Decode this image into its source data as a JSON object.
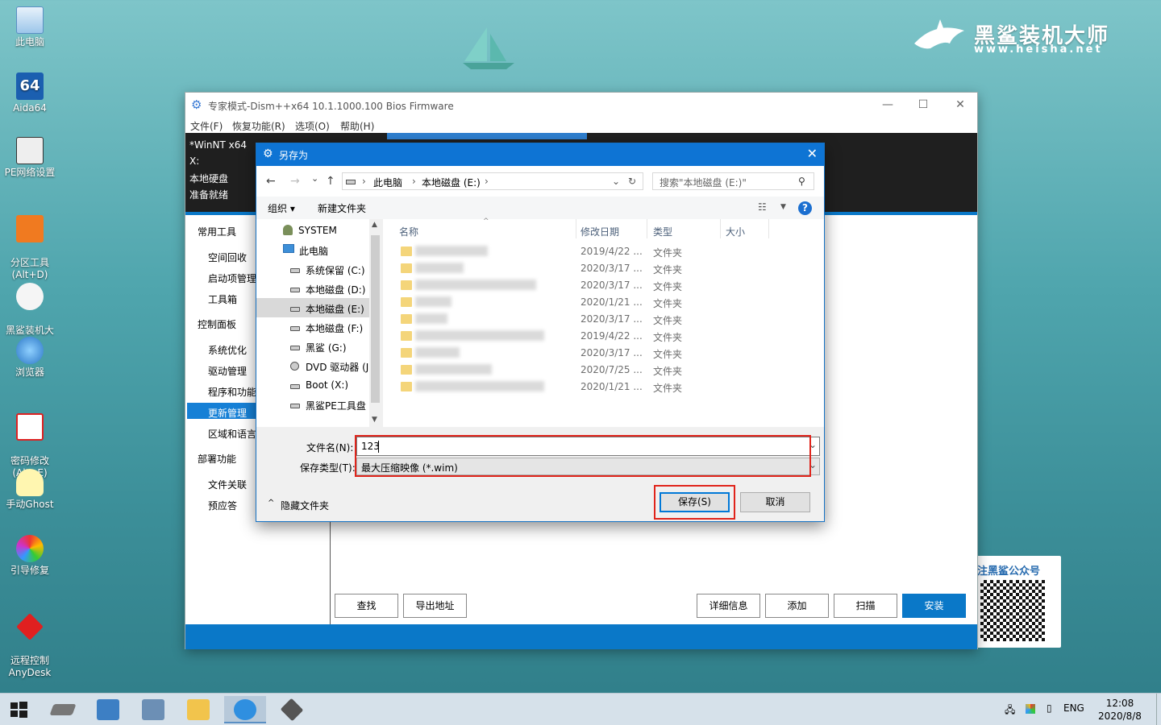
{
  "desktop": {
    "icons": [
      {
        "label": "此电脑"
      },
      {
        "label": "Aida64",
        "glyph": "64"
      },
      {
        "label": "PE网络设置"
      },
      {
        "label": "分区工具\n(Alt+D)"
      },
      {
        "label": "黑鲨装机大\n师"
      },
      {
        "label": "浏览器"
      },
      {
        "label": "密码修改\n(Alt+E)"
      },
      {
        "label": "手动Ghost"
      },
      {
        "label": "引导修复"
      },
      {
        "label": "远程控制\nAnyDesk"
      }
    ],
    "brand": {
      "name": "黑鲨装机大师",
      "url": "www.heisha.net"
    },
    "qr_caption": "注黑鲨公众号"
  },
  "main_window": {
    "title": "专家模式-Dism++x64 10.1.1000.100 Bios Firmware",
    "controls": {
      "minimize": "—",
      "maximize": "☐",
      "close": "✕"
    },
    "menu": [
      "文件(F)",
      "恢复功能(R)",
      "选项(O)",
      "帮助(H)"
    ],
    "info": [
      "*WinNT x64",
      "X:",
      "本地硬盘",
      "准备就绪"
    ],
    "sidebar": {
      "groups": [
        {
          "header": "常用工具",
          "items": [
            "空间回收",
            "启动项管理",
            "工具箱"
          ]
        },
        {
          "header": "控制面板",
          "items": [
            "系统优化",
            "驱动管理",
            "程序和功能",
            "更新管理",
            "区域和语言"
          ]
        },
        {
          "header": "部署功能",
          "items": [
            "文件关联",
            "预应答"
          ]
        }
      ],
      "selected": "更新管理"
    },
    "buttons": {
      "find": "查找",
      "export": "导出地址",
      "details": "详细信息",
      "add": "添加",
      "scan": "扫描",
      "install": "安装"
    }
  },
  "dialog": {
    "title": "另存为",
    "close": "✕",
    "nav": {
      "back": "←",
      "forward": "→",
      "down": "⌄",
      "up": "↑",
      "refresh": "↻"
    },
    "breadcrumb": [
      "此电脑",
      "本地磁盘 (E:)"
    ],
    "search_placeholder": "搜索\"本地磁盘 (E:)\"",
    "toolbar": {
      "organize": "组织 ▾",
      "new_folder": "新建文件夹",
      "help": "?"
    },
    "tree": [
      {
        "label": "SYSTEM"
      },
      {
        "label": "此电脑"
      },
      {
        "label": "系统保留 (C:)"
      },
      {
        "label": "本地磁盘 (D:)"
      },
      {
        "label": "本地磁盘 (E:)"
      },
      {
        "label": "本地磁盘 (F:)"
      },
      {
        "label": "黑鲨 (G:)"
      },
      {
        "label": "DVD 驱动器 (J"
      },
      {
        "label": "Boot (X:)"
      },
      {
        "label": "黑鲨PE工具盘"
      }
    ],
    "tree_selected": "本地磁盘 (E:)",
    "columns": {
      "name": "名称",
      "modified": "修改日期",
      "type": "类型",
      "size": "大小"
    },
    "files": [
      {
        "date": "2019/4/22 ...",
        "type": "文件夹"
      },
      {
        "date": "2020/3/17 ...",
        "type": "文件夹"
      },
      {
        "date": "2020/3/17 ...",
        "type": "文件夹"
      },
      {
        "date": "2020/1/21 ...",
        "type": "文件夹"
      },
      {
        "date": "2020/3/17 ...",
        "type": "文件夹"
      },
      {
        "date": "2019/4/22 ...",
        "type": "文件夹"
      },
      {
        "date": "2020/3/17 ...",
        "type": "文件夹"
      },
      {
        "date": "2020/7/25 ...",
        "type": "文件夹"
      },
      {
        "date": "2020/1/21 ...",
        "type": "文件夹"
      }
    ],
    "filename_label": "文件名(N):",
    "filename_value": "123",
    "filetype_label": "保存类型(T):",
    "filetype_value": "最大压缩映像 (*.wim)",
    "hide_folders": "隐藏文件夹",
    "save": "保存(S)",
    "cancel": "取消"
  },
  "taskbar": {
    "lang": "ENG",
    "time": "12:08",
    "date": "2020/8/8"
  },
  "colors": {
    "accent": "#0a78c8",
    "dialog_title": "#0e74d4",
    "highlight": "#e0241b"
  }
}
